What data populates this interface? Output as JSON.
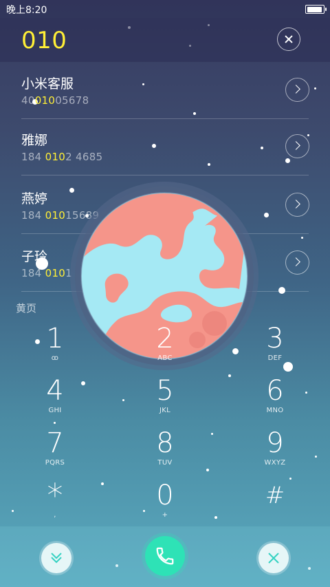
{
  "status_bar": {
    "time": "晚上8:20",
    "battery_level": 1.0
  },
  "dialer": {
    "input": "010"
  },
  "contacts": [
    {
      "name": "小米客服",
      "number_prefix": "40",
      "number_match": "010",
      "number_suffix": "05678"
    },
    {
      "name": "雅娜",
      "number_prefix": "184 ",
      "number_match": "010",
      "number_suffix": "2 4685"
    },
    {
      "name": "燕婷",
      "number_prefix": "184 ",
      "number_match": "010",
      "number_suffix": "15689"
    },
    {
      "name": "子玲",
      "number_prefix": "184 ",
      "number_match": "010",
      "number_suffix": "1"
    }
  ],
  "section": {
    "label": "黄页"
  },
  "keypad": [
    {
      "digit": "1",
      "letters": "ꝏ"
    },
    {
      "digit": "2",
      "letters": "ABC"
    },
    {
      "digit": "3",
      "letters": "DEF"
    },
    {
      "digit": "4",
      "letters": "GHI"
    },
    {
      "digit": "5",
      "letters": "JKL"
    },
    {
      "digit": "6",
      "letters": "MNO"
    },
    {
      "digit": "7",
      "letters": "PQRS"
    },
    {
      "digit": "8",
      "letters": "TUV"
    },
    {
      "digit": "9",
      "letters": "WXYZ"
    },
    {
      "digit": "*",
      "letters": ","
    },
    {
      "digit": "0",
      "letters": "+"
    },
    {
      "digit": "#",
      "letters": ""
    }
  ],
  "icons": {
    "collapse": "chevron-double-down-icon",
    "call": "phone-icon",
    "close": "close-icon",
    "clear": "clear-icon",
    "detail": "chevron-right-icon"
  },
  "colors": {
    "highlight": "#ffef36",
    "call_button": "#2ee2b6",
    "planet_ocean": "#a5e9f4",
    "planet_land": "#f5958a"
  }
}
